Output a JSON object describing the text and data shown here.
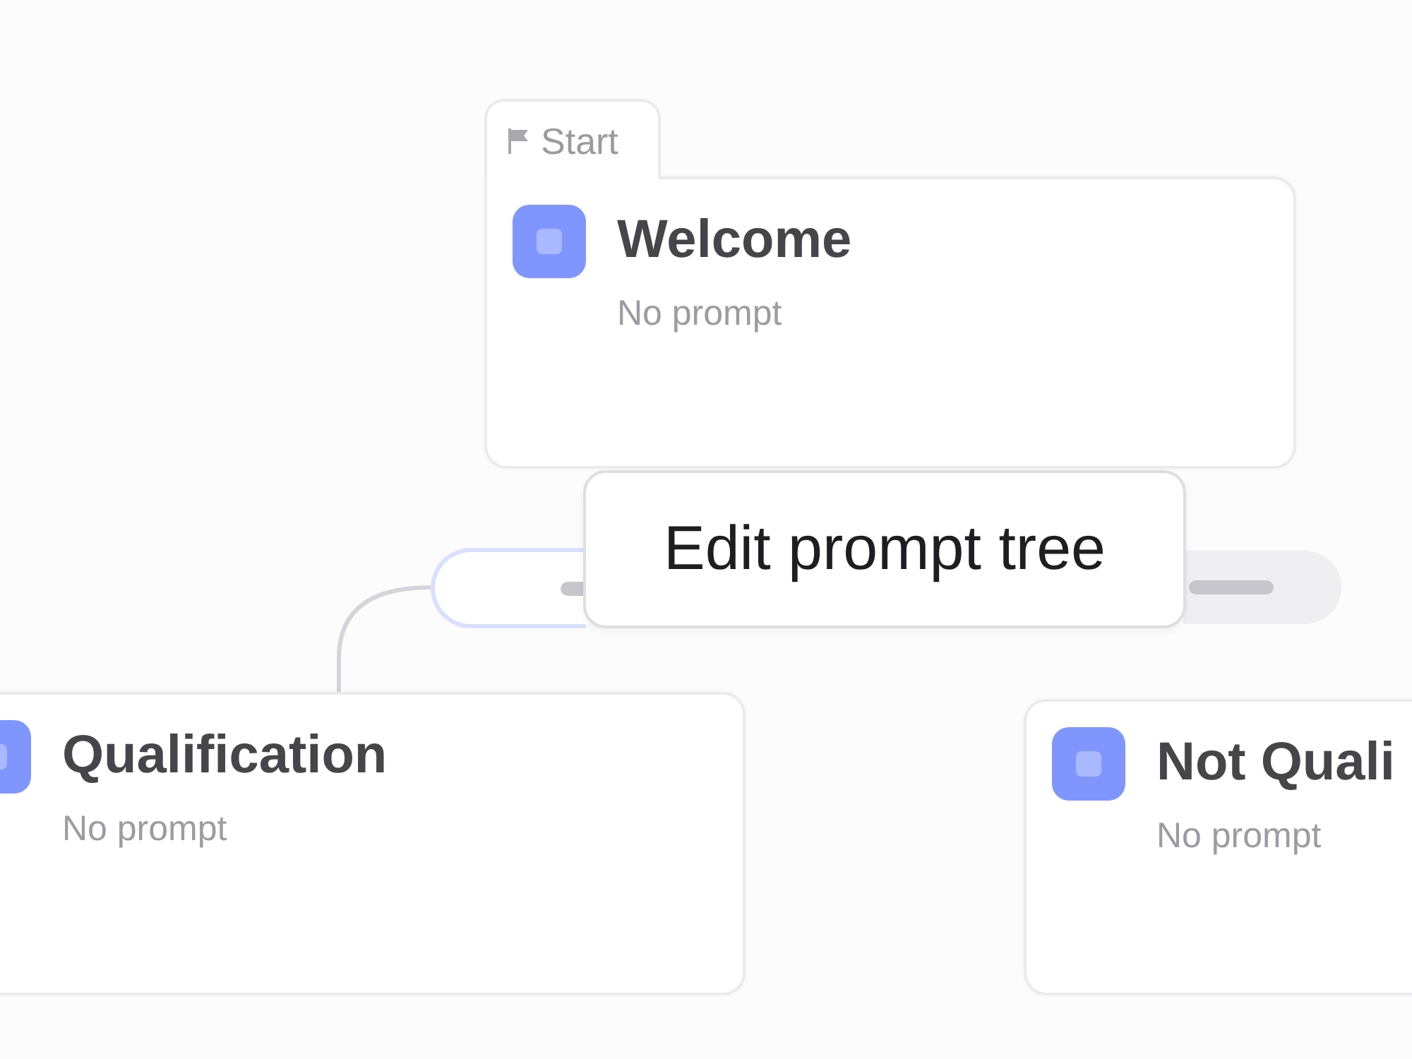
{
  "canvas": {
    "nodes": [
      {
        "badge": "Start",
        "title": "Welcome",
        "subtitle": "No prompt"
      },
      {
        "title": "Qualification",
        "subtitle": "No prompt"
      },
      {
        "title": "Not Quali",
        "subtitle": "No prompt"
      }
    ],
    "branches": [
      {
        "selected": true
      },
      {
        "selected": false
      }
    ]
  },
  "overlay": {
    "button": "Edit prompt tree"
  }
}
